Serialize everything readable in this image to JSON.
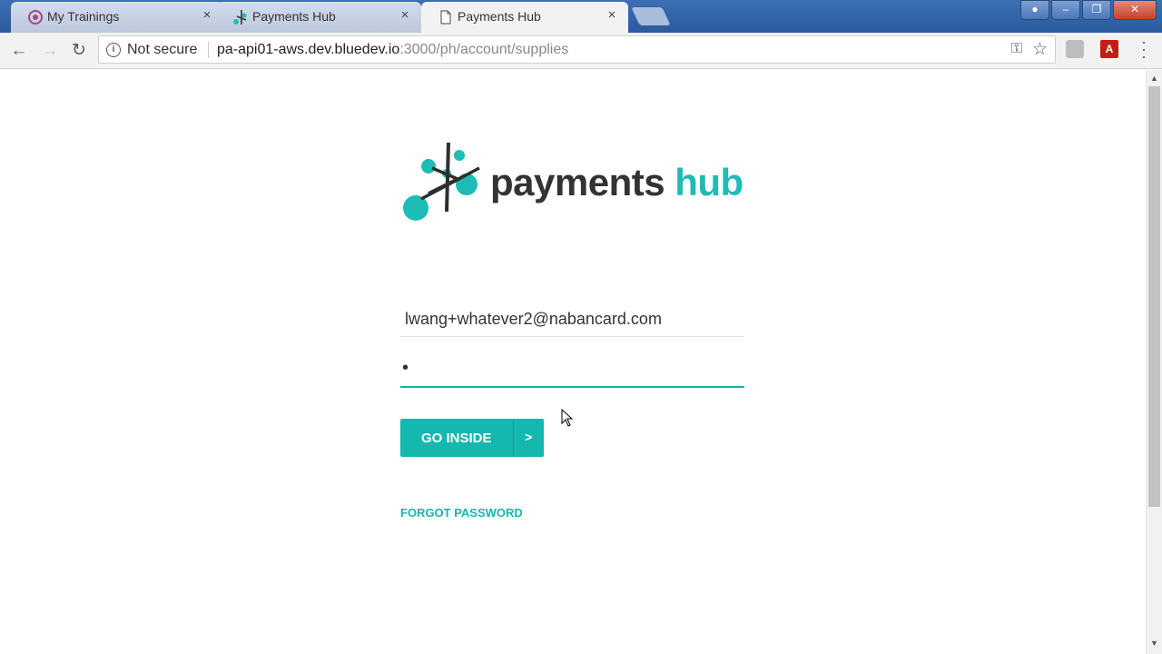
{
  "browser": {
    "tabs": [
      {
        "title": "My Trainings",
        "favicon": "trainings-icon",
        "active": false
      },
      {
        "title": "Payments Hub",
        "favicon": "payments-hub-icon",
        "active": false
      },
      {
        "title": "Payments Hub",
        "favicon": "page-icon",
        "active": true
      }
    ],
    "close_glyph": "×",
    "security_label": "Not secure",
    "url_host": "pa-api01-aws.dev.bluedev.io",
    "url_path": ":3000/ph/account/supplies",
    "colors": {
      "tabstrip": "#2b5a9e",
      "toolbar": "#f2f2f2"
    }
  },
  "login": {
    "brand_word_1": "payments",
    "brand_word_2": "hub",
    "email_value": "lwang+whatever2@nabancard.com",
    "password_value": "•",
    "submit_label": "GO INSIDE",
    "submit_arrow": ">",
    "forgot_label": "FORGOT PASSWORD",
    "colors": {
      "accent": "#16b7ae",
      "brand_dark": "#333333"
    }
  }
}
